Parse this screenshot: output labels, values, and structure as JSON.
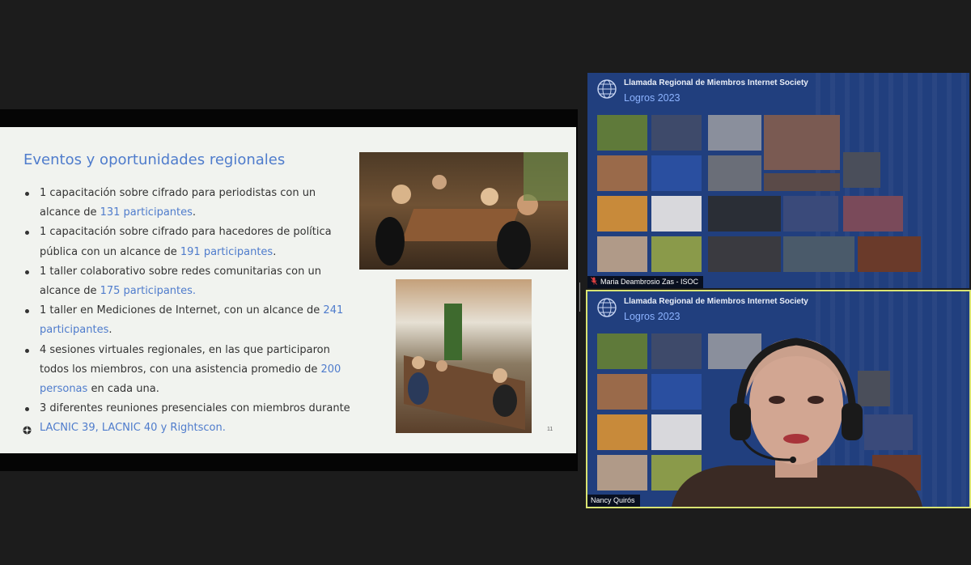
{
  "slide": {
    "title": "Eventos y oportunidades regionales",
    "bullets": [
      {
        "before": "1 capacitación sobre cifrado para periodistas con un alcance de ",
        "highlight": "131 participantes",
        "after": "."
      },
      {
        "before": "1 capacitación sobre cifrado para hacedores de política pública con un alcance de ",
        "highlight": "191 participantes",
        "after": "."
      },
      {
        "before": "1 taller colaborativo sobre redes comunitarias con un alcance de ",
        "highlight": "175 participantes.",
        "after": ""
      },
      {
        "before": "1 taller en Mediciones de Internet, con un alcance de ",
        "highlight": "241 participantes",
        "after": "."
      },
      {
        "before": "4 sesiones virtuales regionales, en las que participaron todos los miembros, con una asistencia promedio de ",
        "highlight": "200 personas",
        "after": " en cada una."
      },
      {
        "before": "3 diferentes reuniones presenciales con miembros durante ",
        "highlight": "LACNIC 39, LACNIC 40 y Rightscon.",
        "after": ""
      }
    ],
    "page_number": "11"
  },
  "tiles": [
    {
      "heading": "Llamada Regional de Miembros Internet Society",
      "subheading": "Logros 2023",
      "participant": "Maria Deambrosio Zas - ISOC",
      "muted": true
    },
    {
      "heading": "Llamada Regional de Miembros Internet Society",
      "subheading": "Logros 2023",
      "participant": "Nancy Quirós",
      "muted": false,
      "active_speaker": true
    }
  ],
  "colors": {
    "slide_accent": "#4f7ccc",
    "tile_background": "#213f7e",
    "active_speaker_border": "#d9e372",
    "muted_icon": "#e34040"
  }
}
